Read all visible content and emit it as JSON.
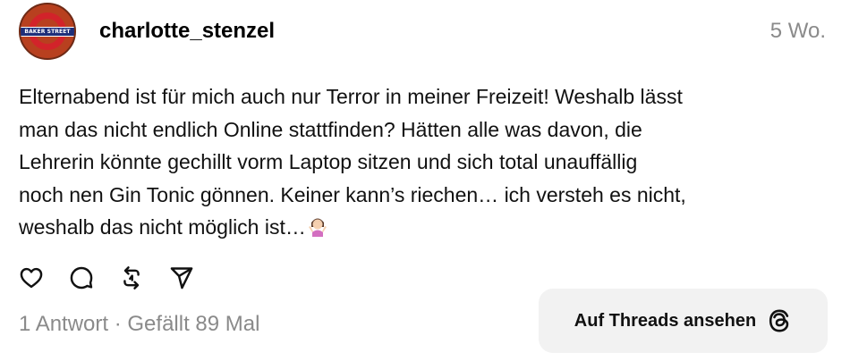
{
  "author": {
    "username": "charlotte_stenzel",
    "avatar_text": "BAKER STREET"
  },
  "post": {
    "timestamp": "5 Wo.",
    "text": "Elternabend ist für mich auch nur Terror in meiner Freizeit! Weshalb lässt\nman das nicht endlich Online stattfinden? Hätten alle was davon, die\nLehrerin könnte gechillt vorm Laptop sitzen und sich total unauffällig\nnoch nen Gin Tonic gönnen. Keiner kann’s riechen… ich versteh es nicht,\nweshalb das nicht möglich ist…",
    "emoji": "woman-shrugging-emoji"
  },
  "actions": {
    "like_icon": "heart-icon",
    "comment_icon": "comment-icon",
    "repost_icon": "repost-icon",
    "share_icon": "send-icon"
  },
  "stats": {
    "summary": "1 Antwort · Gefällt 89 Mal"
  },
  "cta": {
    "label": "Auf Threads ansehen",
    "icon": "threads-logo-icon"
  },
  "colors": {
    "text": "#111111",
    "muted": "#8a8a8a",
    "button_bg": "#f2f2f2"
  }
}
